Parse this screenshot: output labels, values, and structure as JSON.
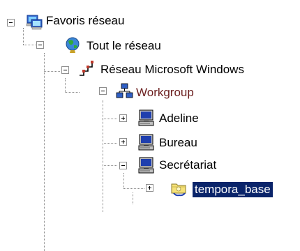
{
  "tree": {
    "favoris": {
      "label": "Favoris réseau",
      "icon": "network-favorites-icon",
      "state": "expanded"
    },
    "tout": {
      "label": "Tout le réseau",
      "icon": "globe-icon",
      "state": "expanded"
    },
    "msnet": {
      "label": "Réseau Microsoft Windows",
      "icon": "network-cable-icon",
      "state": "expanded"
    },
    "workgroup": {
      "label": "Workgroup",
      "icon": "workgroup-icon",
      "state": "expanded",
      "color": "#6b1e1e"
    },
    "adeline": {
      "label": "Adeline",
      "icon": "computer-icon",
      "state": "collapsed"
    },
    "bureau": {
      "label": "Bureau",
      "icon": "computer-icon",
      "state": "collapsed"
    },
    "secretariat": {
      "label": "Secrétariat",
      "icon": "computer-icon",
      "state": "expanded"
    },
    "tempora": {
      "label": "tempora_base",
      "icon": "shared-folder-icon",
      "state": "collapsed",
      "selected": true,
      "selection_color": "#0a246a"
    }
  }
}
